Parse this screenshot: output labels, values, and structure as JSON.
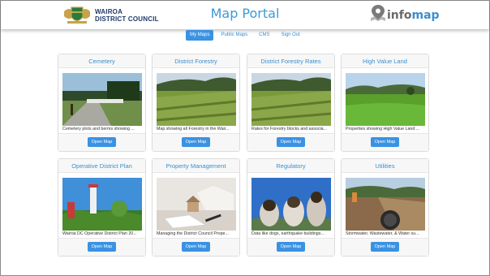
{
  "header": {
    "logo": {
      "line1": "WAIROA",
      "line2": "DISTRICT COUNCIL"
    },
    "title": "Map Portal",
    "brand": {
      "part1": "info",
      "part2": "map"
    }
  },
  "nav": [
    "My Maps",
    "Public Maps",
    "CMS",
    "Sign Out"
  ],
  "cards": [
    {
      "title": "Cemetery",
      "desc": "Cemetery plots and berms showing ...",
      "button": "Open Map"
    },
    {
      "title": "District Forestry",
      "desc": "Map showing all Forestry in the Wair...",
      "button": "Open Map"
    },
    {
      "title": "District Forestry Rates",
      "desc": "Rates for Forestry blocks and associa...",
      "button": "Open Map"
    },
    {
      "title": "High Value Land",
      "desc": "Properties showing High Value Land ...",
      "button": "Open Map"
    },
    {
      "title": "Operative District Plan",
      "desc": "Wairoa DC Operative District Plan 20...",
      "button": "Open Map"
    },
    {
      "title": "Property Management",
      "desc": "Managing the District Council Prope...",
      "button": "Open Map"
    },
    {
      "title": "Regulatory",
      "desc": "Data like dogs, earthquake buildings...",
      "button": "Open Map"
    },
    {
      "title": "Utilities",
      "desc": "Stormwater, Wastewater, & Water su...",
      "button": "Open Map"
    }
  ],
  "colors": {
    "accent": "#3a92e3",
    "title": "#3a9ad9",
    "brand_dark": "#203a6a"
  }
}
